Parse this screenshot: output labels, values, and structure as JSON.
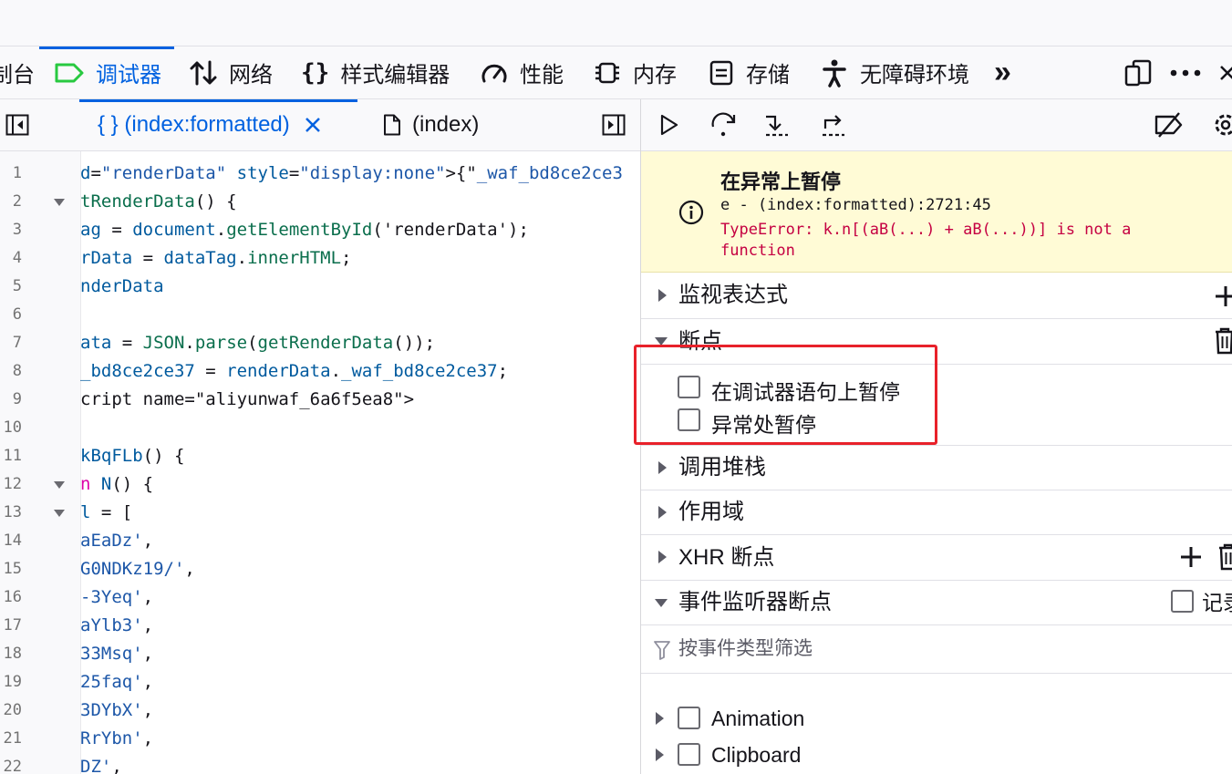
{
  "toolbar": {
    "tabs": [
      {
        "label": "制台",
        "icon": "console-icon"
      },
      {
        "label": "调试器",
        "icon": "debugger-icon"
      },
      {
        "label": "网络",
        "icon": "network-icon"
      },
      {
        "label": "样式编辑器",
        "icon": "braces-icon"
      },
      {
        "label": "性能",
        "icon": "gauge-icon"
      },
      {
        "label": "内存",
        "icon": "memory-chip-icon"
      },
      {
        "label": "存储",
        "icon": "storage-icon"
      },
      {
        "label": "无障碍环境",
        "icon": "accessibility-icon"
      }
    ],
    "more_label": "»",
    "accent_color": "#0061e0"
  },
  "editor_tabs": [
    {
      "label": "{ } (index:formatted)",
      "active": true
    },
    {
      "label": "(index)",
      "active": false
    }
  ],
  "editor": {
    "lines": [
      {
        "n": "1",
        "fold": false,
        "segs": [
          [
            "c-attr",
            "d"
          ],
          [
            "",
            "="
          ],
          [
            "c-str",
            "\"renderData\""
          ],
          [
            "",
            " "
          ],
          [
            "c-attr",
            "style"
          ],
          [
            "",
            "="
          ],
          [
            "c-str",
            "\"display:none\""
          ],
          [
            "",
            ">{\""
          ],
          [
            "c-str",
            "_waf_bd8ce2ce3"
          ]
        ]
      },
      {
        "n": "2",
        "fold": true,
        "segs": [
          [
            "c-fn",
            "tRenderData"
          ],
          [
            "",
            "() {"
          ]
        ]
      },
      {
        "n": "3",
        "fold": false,
        "segs": [
          [
            "c-attr",
            "ag"
          ],
          [
            "",
            " = "
          ],
          [
            "c-attr",
            "document"
          ],
          [
            "",
            "."
          ],
          [
            "c-fn",
            "getElementById"
          ],
          [
            "",
            "('renderData');"
          ]
        ]
      },
      {
        "n": "4",
        "fold": false,
        "segs": [
          [
            "c-attr",
            "rData"
          ],
          [
            "",
            " = "
          ],
          [
            "c-attr",
            "dataTag"
          ],
          [
            "",
            "."
          ],
          [
            "c-fn",
            "innerHTML"
          ],
          [
            "",
            ";"
          ]
        ]
      },
      {
        "n": "5",
        "fold": false,
        "segs": [
          [
            "c-attr",
            "nderData"
          ]
        ]
      },
      {
        "n": "6",
        "fold": false,
        "segs": []
      },
      {
        "n": "7",
        "fold": false,
        "segs": [
          [
            "c-attr",
            "ata"
          ],
          [
            "",
            " = "
          ],
          [
            "c-fn",
            "JSON"
          ],
          [
            "",
            "."
          ],
          [
            "c-fn",
            "parse"
          ],
          [
            "",
            "("
          ],
          [
            "c-fn",
            "getRenderData"
          ],
          [
            "",
            "());"
          ]
        ]
      },
      {
        "n": "8",
        "fold": false,
        "segs": [
          [
            "c-attr",
            "_bd8ce2ce37"
          ],
          [
            "",
            " = "
          ],
          [
            "c-attr",
            "renderData"
          ],
          [
            "",
            "."
          ],
          [
            "c-attr",
            "_waf_bd8ce2ce37"
          ],
          [
            "",
            ";"
          ]
        ]
      },
      {
        "n": "9",
        "fold": false,
        "segs": [
          [
            "",
            "cript name=\"aliyunwaf_6a6f5ea8\">"
          ]
        ]
      },
      {
        "n": "10",
        "fold": false,
        "segs": []
      },
      {
        "n": "11",
        "fold": false,
        "segs": [
          [
            "c-attr",
            "kBqFLb"
          ],
          [
            "",
            "() {"
          ]
        ]
      },
      {
        "n": "12",
        "fold": true,
        "segs": [
          [
            "c-kw",
            "n"
          ],
          [
            "",
            " "
          ],
          [
            "c-attr",
            "N"
          ],
          [
            "",
            "() {"
          ]
        ]
      },
      {
        "n": "13",
        "fold": true,
        "segs": [
          [
            "c-attr",
            "l"
          ],
          [
            "",
            " = ["
          ]
        ]
      },
      {
        "n": "14",
        "fold": false,
        "segs": [
          [
            "c-str",
            "aEaDz'"
          ],
          [
            "",
            ","
          ]
        ]
      },
      {
        "n": "15",
        "fold": false,
        "segs": [
          [
            "c-str",
            "G0NDKz19/'"
          ],
          [
            "",
            ","
          ]
        ]
      },
      {
        "n": "16",
        "fold": false,
        "segs": [
          [
            "c-str",
            "-3Yeq'"
          ],
          [
            "",
            ","
          ]
        ]
      },
      {
        "n": "17",
        "fold": false,
        "segs": [
          [
            "c-str",
            "aYlb3'"
          ],
          [
            "",
            ","
          ]
        ]
      },
      {
        "n": "18",
        "fold": false,
        "segs": [
          [
            "c-str",
            "33Msq'"
          ],
          [
            "",
            ","
          ]
        ]
      },
      {
        "n": "19",
        "fold": false,
        "segs": [
          [
            "c-str",
            "25faq'"
          ],
          [
            "",
            ","
          ]
        ]
      },
      {
        "n": "20",
        "fold": false,
        "segs": [
          [
            "c-str",
            "3DYbX'"
          ],
          [
            "",
            ","
          ]
        ]
      },
      {
        "n": "21",
        "fold": false,
        "segs": [
          [
            "c-str",
            "RrYbn'"
          ],
          [
            "",
            ","
          ]
        ]
      },
      {
        "n": "22",
        "fold": false,
        "segs": [
          [
            "c-str",
            "DZ'"
          ],
          [
            "",
            ","
          ]
        ]
      }
    ]
  },
  "pause": {
    "title": "在异常上暂停",
    "location": "e - (index:formatted):2721:45",
    "message": "TypeError: k.n[(aB(...) + aB(...))] is not a function"
  },
  "sections": {
    "watch": "监视表达式",
    "breakpoints": "断点",
    "pause_on_debugger": "在调试器语句上暂停",
    "pause_on_exceptions": "异常处暂停",
    "call_stack": "调用堆栈",
    "scopes": "作用域",
    "xhr": "XHR 断点",
    "event_listeners": "事件监听器断点",
    "log_label": "记录",
    "filter_placeholder": "按事件类型筛选",
    "events": [
      "Animation",
      "Clipboard"
    ]
  }
}
